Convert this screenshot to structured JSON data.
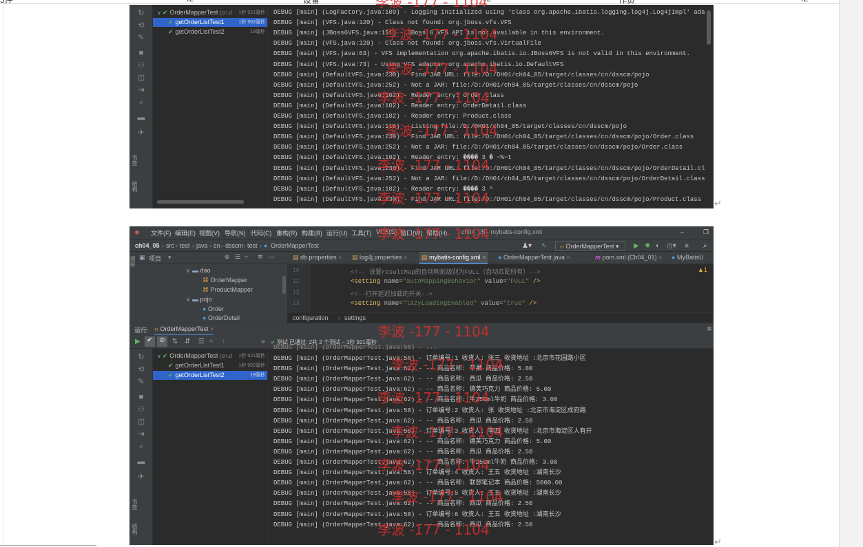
{
  "doc": {
    "ruler_labels": [
      "5件",
      "42",
      "设备",
      "42",
      "作员",
      "42",
      "编辑"
    ],
    "para_mark": "↵"
  },
  "watermark": {
    "text": "李波 -177 - 1104"
  },
  "colors": {
    "ide_bg": "#2b2b2b",
    "ide_panel": "#3c3f41",
    "selection": "#2f65ca",
    "pass_green": "#5fb85f",
    "xml_tag": "#e8bf6a",
    "xml_attr": "#bababa",
    "xml_value": "#6a8759",
    "comment": "#808080",
    "watermark": "#dc2d2d"
  },
  "shot1": {
    "tree": [
      {
        "label": "OrderMapperTest",
        "suffix": "(cn.d",
        "time": "1秒 921毫秒",
        "selected": false,
        "indent": 0
      },
      {
        "label": "getOrderListTest1",
        "suffix": "",
        "time": "1秒 902毫秒",
        "selected": true,
        "indent": 1
      },
      {
        "label": "getOrderListTest2",
        "suffix": "",
        "time": "19毫秒",
        "selected": false,
        "indent": 1
      }
    ],
    "vertical_labels": [
      "书签",
      "结构"
    ],
    "console": [
      "DEBUG [main] (LogFactory.java:109) - Logging initialized using 'class org.apache.ibatis.logging.log4j.Log4jImpl' ada",
      "DEBUG [main] (VFS.java:120) - Class not found: org.jboss.vfs.VFS",
      "DEBUG [main] (JBoss6VFS.java:151) - JBoss 6 VFS API is not available in this environment.",
      "DEBUG [main] (VFS.java:120) - Class not found: org.jboss.vfs.VirtualFile",
      "DEBUG [main] (VFS.java:63) - VFS implementation org.apache.ibatis.io.JBoss6VFS is not valid in this environment.",
      "DEBUG [main] (VFS.java:73) - Using VFS adapter org.apache.ibatis.io.DefaultVFS",
      "DEBUG [main] (DefaultVFS.java:230) - Find JAR URL: file:/D:/DH01/ch04_05/target/classes/cn/dsscm/pojo",
      "DEBUG [main] (DefaultVFS.java:252) - Not a JAR: file:/D:/DH01/ch04_05/target/classes/cn/dsscm/pojo",
      "DEBUG [main] (DefaultVFS.java:102) - Reader entry: Order.class",
      "DEBUG [main] (DefaultVFS.java:102) - Reader entry: OrderDetail.class",
      "DEBUG [main] (DefaultVFS.java:102) - Reader entry: Product.class",
      "DEBUG [main] (DefaultVFS.java:116) - Listing file:/D:/DH01/ch04_05/target/classes/cn/dsscm/pojo",
      "DEBUG [main] (DefaultVFS.java:230) - Find JAR URL: file:/D:/DH01/ch04_05/target/classes/cn/dsscm/pojo/Order.class",
      "DEBUG [main] (DefaultVFS.java:252) - Not a JAR: file:/D:/DH01/ch04_05/target/classes/cn/dsscm/pojo/Order.class",
      "DEBUG [main] (DefaultVFS.java:102) - Reader entry: ����   3 �   ~%~t",
      "DEBUG [main] (DefaultVFS.java:230) - Find JAR URL: file:/D:/DH01/ch04_05/target/classes/cn/dsscm/pojo/OrderDetail.cl",
      "DEBUG [main] (DefaultVFS.java:252) - Not a JAR: file:/D:/DH01/ch04_05/target/classes/cn/dsscm/pojo/OrderDetail.class",
      "DEBUG [main] (DefaultVFS.java:102) - Reader entry: ����   3 ^",
      "DEBUG [main] (DefaultVFS.java:230) - Find JAR URL: file:/D:/DH01/ch04_05/target/classes/cn/dsscm/pojo/Product.class"
    ]
  },
  "shot2": {
    "menu": [
      "文件(F)",
      "编辑(E)",
      "视图(V)",
      "导航(N)",
      "代码(C)",
      "重构(R)",
      "构建(B)",
      "运行(U)",
      "工具(T)",
      "VCS(S)",
      "窗口(W)",
      "帮助(H)"
    ],
    "window_title": "ch04_05 - mybatis-config.xml",
    "breadcrumbs": [
      "ch04_05",
      "src",
      "test",
      "java",
      "cn",
      "dsscm",
      "test",
      "OrderMapperTest"
    ],
    "run_config": "OrderMapperTest",
    "project_pane": {
      "title": "项目",
      "items": [
        {
          "label": "dao",
          "type": "folder",
          "indent": 0
        },
        {
          "label": "OrderMapper",
          "type": "xml",
          "indent": 1
        },
        {
          "label": "ProductMapper",
          "type": "xml",
          "indent": 1
        },
        {
          "label": "pojo",
          "type": "folder",
          "indent": 0
        },
        {
          "label": "Order",
          "type": "class",
          "indent": 1
        },
        {
          "label": "OrderDetail",
          "type": "class",
          "indent": 1
        }
      ]
    },
    "tabs": [
      {
        "label": "db.properties",
        "active": false
      },
      {
        "label": "log4j.properties",
        "active": false
      },
      {
        "label": "mybatis-config.xml",
        "active": true
      },
      {
        "label": "OrderMapperTest.java",
        "active": false
      },
      {
        "label": "pom.xml (Ch04_01)",
        "active": false
      },
      {
        "label": "MyBatisU",
        "active": false
      }
    ],
    "warning_count": "▲1",
    "code": [
      {
        "line": "10",
        "kind": "comment",
        "text": "<!-- 设置resultMap的自动映射级别为FULL（自动匹配所有）-->"
      },
      {
        "line": "11",
        "kind": "setting",
        "name": "autoMappingBehavior",
        "value": "FULL"
      },
      {
        "line": "12",
        "kind": "comment",
        "text": "<!--打开延迟加载的开关-->"
      },
      {
        "line": "13",
        "kind": "setting",
        "name": "lazyLoadingEnabled",
        "value": "true"
      }
    ],
    "code_tokens": {
      "open": "<setting ",
      "name_attr": "name=",
      "value_attr": " value=",
      "close": " />"
    },
    "editor_breadcrumb": [
      "configuration",
      "settings"
    ],
    "run_label": "运行:",
    "run_tab": "OrderMapperTest",
    "test_status": "测试 已通过: 2共 2 个测试 – 1秒 921毫秒",
    "tree": [
      {
        "label": "OrderMapperTest",
        "suffix": "(cn.d",
        "time": "1秒 921毫秒",
        "selected": false,
        "indent": 0
      },
      {
        "label": "getOrderListTest1",
        "suffix": "",
        "time": "1秒 902毫秒",
        "selected": false,
        "indent": 1
      },
      {
        "label": "getOrderListTest2",
        "suffix": "",
        "time": "19毫秒",
        "selected": true,
        "indent": 1
      }
    ],
    "vertical_labels": [
      "书签",
      "结构"
    ],
    "console_top_partial": "DEBUG [main] (OrderMapperTest.java:58) - ...",
    "console": [
      "DEBUG [main] (OrderMapperTest.java:58) - 订单编号:1  收货人:  张三  收货地址 :北京市花园路小区",
      "DEBUG [main] (OrderMapperTest.java:62) -   -- 商品名称: 苹果  商品价格:  5.00",
      "DEBUG [main] (OrderMapperTest.java:62) -   -- 商品名称: 西瓜  商品价格:  2.50",
      "DEBUG [main] (OrderMapperTest.java:62) -   -- 商品名称: 德芙巧克力  商品价格:  5.00",
      "DEBUG [main] (OrderMapperTest.java:62) -   -- 商品名称: 牛250ml牛奶  商品价格:  3.00",
      "DEBUG [main] (OrderMapperTest.java:58) - 订单编号:2  收货人:  张  收货地址 :北京市海淀区成府路",
      "DEBUG [main] (OrderMapperTest.java:62) -   -- 商品名称: 西瓜  商品价格:  2.50",
      "DEBUG [main] (OrderMapperTest.java:58) - 订单编号:3  收货人:  李四  收货地址 :北京市海淀区人有开",
      "DEBUG [main] (OrderMapperTest.java:62) -   -- 商品名称: 德芙巧克力  商品价格:  5.00",
      "DEBUG [main] (OrderMapperTest.java:62) -   -- 商品名称: 西瓜  商品价格:  2.50",
      "DEBUG [main] (OrderMapperTest.java:62) -   -- 商品名称: 牛250ml牛奶  商品价格:  3.00",
      "DEBUG [main] (OrderMapperTest.java:58) - 订单编号:4  收货人:  王五  收货地址 :湖南长沙",
      "DEBUG [main] (OrderMapperTest.java:62) -   -- 商品名称: 联想笔记本  商品价格:  5000.00",
      "DEBUG [main] (OrderMapperTest.java:58) - 订单编号:5  收货人:  王五  收货地址 :湖南长沙",
      "DEBUG [main] (OrderMapperTest.java:62) -   -- 商品名称: 西瓜  商品价格:  2.50",
      "DEBUG [main] (OrderMapperTest.java:58) - 订单编号:6  收货人:  王五  收货地址 :湖南长沙",
      "DEBUG [main] (OrderMapperTest.java:62) -   -- 商品名称: 西瓜  商品价格:  2.50"
    ]
  }
}
